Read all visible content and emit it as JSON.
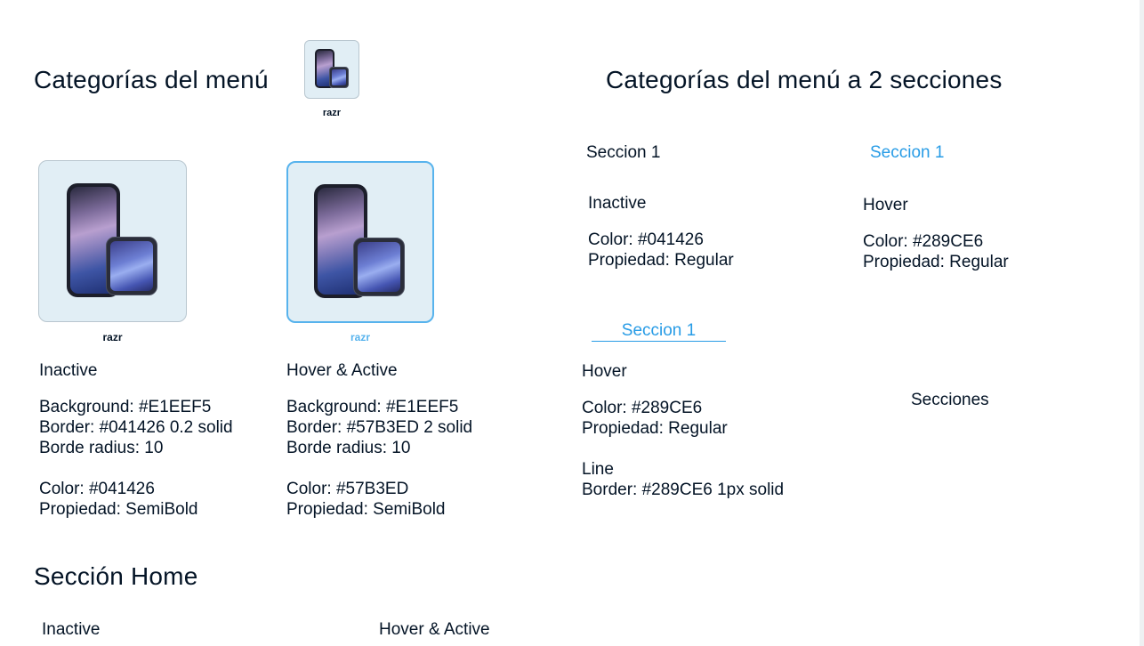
{
  "left": {
    "title": "Categorías del menú",
    "thumb_caption": "razr",
    "inactive_card": {
      "caption": "razr",
      "state": "Inactive",
      "background": "Background: #E1EEF5",
      "border": "Border: #041426 0.2 solid",
      "radius": "Borde radius: 10",
      "color": "Color: #041426",
      "weight": "Propiedad: SemiBold"
    },
    "hover_card": {
      "caption": "razr",
      "state": "Hover & Active",
      "background": "Background: #E1EEF5",
      "border": "Border: #57B3ED 2 solid",
      "radius": "Borde radius: 10",
      "color": "Color: #57B3ED",
      "weight": "Propiedad: SemiBold"
    },
    "home_title": "Sección Home",
    "home_inactive": "Inactive",
    "home_hover": "Hover & Active"
  },
  "right": {
    "title": "Categorías del menú a 2 secciones",
    "inactive": {
      "label": "Seccion 1",
      "state": "Inactive",
      "color": "Color: #041426",
      "weight": "Propiedad: Regular"
    },
    "hover": {
      "label": "Seccion 1",
      "state": "Hover",
      "color": "Color: #289CE6",
      "weight": "Propiedad: Regular"
    },
    "hover_line": {
      "label": "Seccion 1",
      "state": "Hover",
      "color": "Color: #289CE6",
      "weight": "Propiedad: Regular",
      "line_label": "Line",
      "line_border": "Border: #289CE6 1px solid"
    },
    "secciones": "Secciones"
  },
  "colors": {
    "text": "#041426",
    "card_bg": "#E1EEF5",
    "active_border": "#57B3ED",
    "link": "#289CE6"
  },
  "icons": [
    "phone-image-icon"
  ]
}
